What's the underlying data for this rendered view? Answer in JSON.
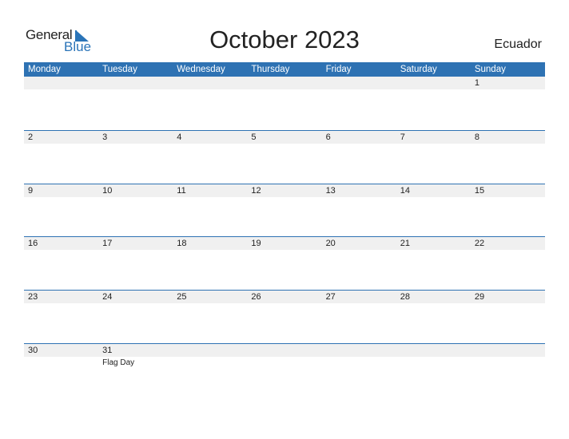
{
  "logo": {
    "line1": "General",
    "line2": "Blue"
  },
  "title": "October 2023",
  "country": "Ecuador",
  "days": [
    "Monday",
    "Tuesday",
    "Wednesday",
    "Thursday",
    "Friday",
    "Saturday",
    "Sunday"
  ],
  "weeks": [
    {
      "dates": [
        "",
        "",
        "",
        "",
        "",
        "",
        "1"
      ],
      "holidays": [
        "",
        "",
        "",
        "",
        "",
        "",
        ""
      ]
    },
    {
      "dates": [
        "2",
        "3",
        "4",
        "5",
        "6",
        "7",
        "8"
      ],
      "holidays": [
        "",
        "",
        "",
        "",
        "",
        "",
        ""
      ]
    },
    {
      "dates": [
        "9",
        "10",
        "11",
        "12",
        "13",
        "14",
        "15"
      ],
      "holidays": [
        "",
        "",
        "",
        "",
        "",
        "",
        ""
      ]
    },
    {
      "dates": [
        "16",
        "17",
        "18",
        "19",
        "20",
        "21",
        "22"
      ],
      "holidays": [
        "",
        "",
        "",
        "",
        "",
        "",
        ""
      ]
    },
    {
      "dates": [
        "23",
        "24",
        "25",
        "26",
        "27",
        "28",
        "29"
      ],
      "holidays": [
        "",
        "",
        "",
        "",
        "",
        "",
        ""
      ]
    },
    {
      "dates": [
        "30",
        "31",
        "",
        "",
        "",
        "",
        ""
      ],
      "holidays": [
        "",
        "Flag Day",
        "",
        "",
        "",
        "",
        ""
      ]
    }
  ],
  "colors": {
    "accent": "#2e72b3",
    "row_bg": "#f0f0f0"
  }
}
